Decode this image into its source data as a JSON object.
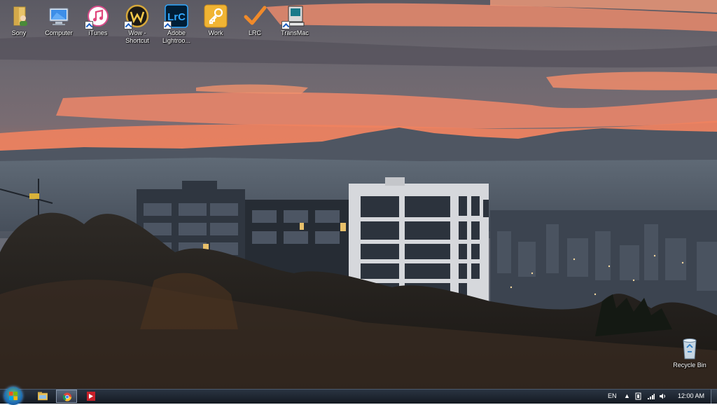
{
  "desktop": {
    "icons": [
      {
        "id": "sony",
        "label": "Sony",
        "icon": "folder-user-icon"
      },
      {
        "id": "computer",
        "label": "Computer",
        "icon": "computer-icon"
      },
      {
        "id": "itunes",
        "label": "iTunes",
        "icon": "itunes-icon",
        "shortcut": true
      },
      {
        "id": "wow",
        "label": "Wow - Shortcut",
        "icon": "world-of-warcraft-icon",
        "shortcut": true
      },
      {
        "id": "lightroom",
        "label": "Adobe Lightroo...",
        "icon": "lightroom-icon",
        "shortcut": true,
        "logo_text": "LrC"
      },
      {
        "id": "work",
        "label": "Work",
        "icon": "key-folder-icon"
      },
      {
        "id": "lrc",
        "label": "LRC",
        "icon": "checkmark-icon"
      },
      {
        "id": "transmac",
        "label": "TransMac",
        "icon": "transmac-icon",
        "shortcut": true
      }
    ],
    "recycle_bin": {
      "label": "Recycle Bin",
      "icon": "recycle-bin-icon"
    }
  },
  "taskbar": {
    "language": "EN",
    "clock": "12:00 AM",
    "buttons": [
      {
        "id": "explorer",
        "icon": "file-explorer-icon"
      },
      {
        "id": "chrome",
        "icon": "chrome-icon",
        "active": true
      },
      {
        "id": "app",
        "icon": "red-app-icon"
      }
    ]
  },
  "colors": {
    "taskbar_top": "#2a3442",
    "taskbar_bottom": "#141a22",
    "sky_glow": "#f07d5e"
  }
}
